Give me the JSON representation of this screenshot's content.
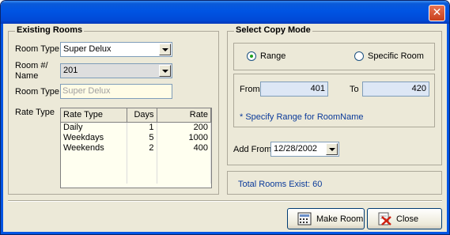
{
  "window": {
    "close_glyph": "✕"
  },
  "existing": {
    "legend": "Existing Rooms",
    "room_type_label": "Room Type",
    "room_type_value": "Super Delux",
    "room_name_label": "Room #/ Name",
    "room_name_value": "201",
    "room_type2_label": "Room Type",
    "room_type2_value": "Super Delux",
    "rate_type_label": "Rate Type",
    "grid": {
      "columns": [
        "Rate Type",
        "Days",
        "Rate"
      ],
      "rows": [
        [
          "Daily",
          "1",
          "200"
        ],
        [
          "Weekdays",
          "5",
          "1000"
        ],
        [
          "Weekends",
          "2",
          "400"
        ]
      ]
    }
  },
  "copy": {
    "legend": "Select Copy Mode",
    "range_label": "Range",
    "specific_label": "Specific Room",
    "selected": "range",
    "from_label": "From",
    "from_value": "401",
    "to_label": "To",
    "to_value": "420",
    "hint": "* Specify Range for RoomName",
    "add_from_label": "Add From",
    "add_from_value": "12/28/2002"
  },
  "status": {
    "total_rooms": "Total Rooms Exist: 60"
  },
  "buttons": {
    "make_room": "Make Room",
    "close": "Close"
  },
  "icons": {
    "title_close": "close-icon",
    "make_room": "calculator-icon",
    "close": "close-doc-icon"
  }
}
